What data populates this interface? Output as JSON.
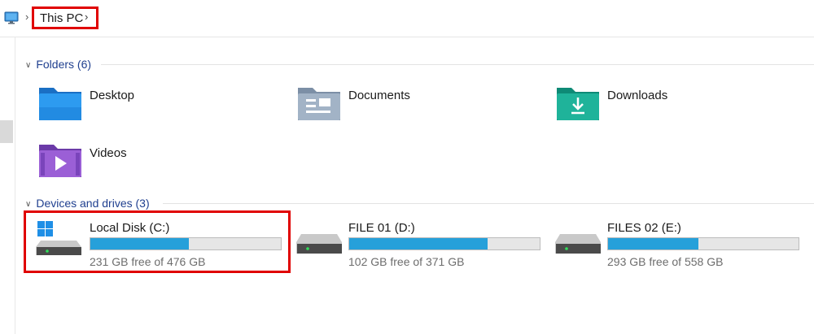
{
  "breadcrumb": {
    "current": "This PC"
  },
  "folders": {
    "header": "Folders (6)",
    "items": [
      {
        "label": "Desktop",
        "icon": "desktop-folder-icon"
      },
      {
        "label": "Documents",
        "icon": "documents-folder-icon"
      },
      {
        "label": "Downloads",
        "icon": "downloads-folder-icon"
      },
      {
        "label": "Videos",
        "icon": "videos-folder-icon"
      }
    ]
  },
  "drives": {
    "header": "Devices and drives (3)",
    "items": [
      {
        "label": "Local Disk (C:)",
        "free": "231 GB free of 476 GB",
        "used_fraction": 0.515
      },
      {
        "label": "FILE 01 (D:)",
        "free": "102 GB free of 371 GB",
        "used_fraction": 0.725
      },
      {
        "label": "FILES 02 (E:)",
        "free": "293 GB free of 558 GB",
        "used_fraction": 0.475
      }
    ]
  },
  "colors": {
    "accent_bar": "#26a0da",
    "highlight": "#e00000",
    "group_header": "#1f3f8f"
  }
}
